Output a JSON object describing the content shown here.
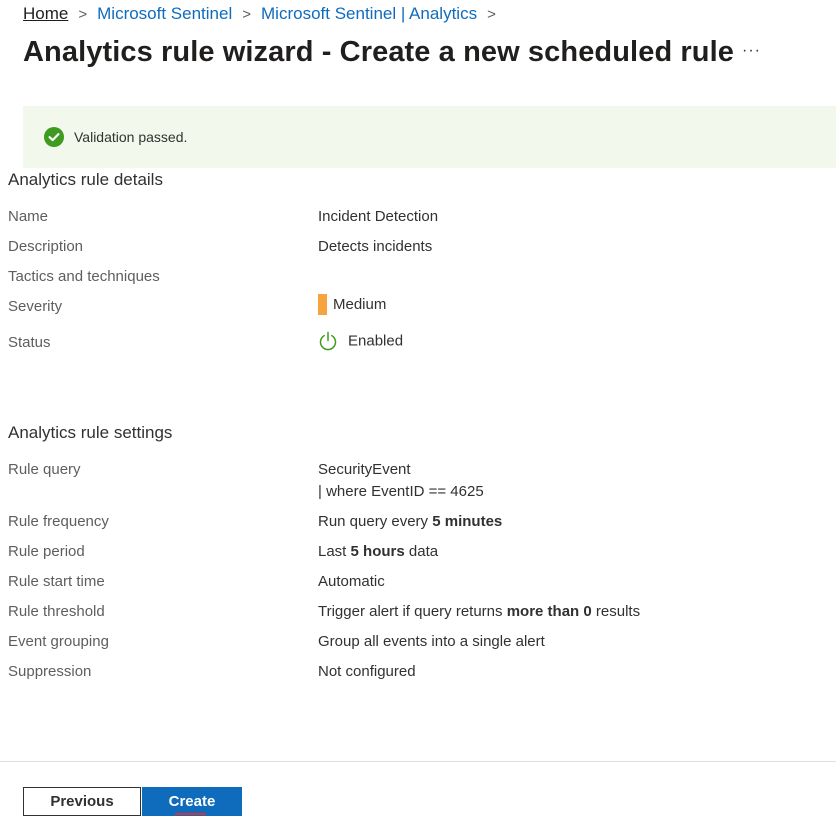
{
  "breadcrumb": {
    "items": [
      "Home",
      "Microsoft Sentinel",
      "Microsoft Sentinel | Analytics"
    ],
    "separator": ">"
  },
  "title": "Analytics rule wizard - Create a new scheduled rule",
  "more_label": "···",
  "banner": {
    "text": "Validation passed.",
    "color": "#f2f9ec",
    "icon": "check-circle-icon",
    "icon_color": "#3e9b1f"
  },
  "details": {
    "heading": "Analytics rule details",
    "name": {
      "label": "Name",
      "value": "Incident Detection"
    },
    "description": {
      "label": "Description",
      "value": "Detects incidents"
    },
    "tactics": {
      "label": "Tactics and techniques",
      "value": ""
    },
    "severity": {
      "label": "Severity",
      "value": "Medium",
      "color": "#f7a440"
    },
    "status": {
      "label": "Status",
      "value": "Enabled",
      "icon": "power-icon",
      "icon_color": "#3e9b1f"
    }
  },
  "settings": {
    "heading": "Analytics rule settings",
    "rule_query": {
      "label": "Rule query",
      "line1": "SecurityEvent",
      "line2": "| where EventID == 4625"
    },
    "rule_frequency": {
      "label": "Rule frequency",
      "prefix": "Run query every ",
      "bold": "5 minutes"
    },
    "rule_period": {
      "label": "Rule period",
      "prefix": "Last ",
      "bold": "5 hours",
      "suffix": " data"
    },
    "rule_start_time": {
      "label": "Rule start time",
      "value": "Automatic"
    },
    "rule_threshold": {
      "label": "Rule threshold",
      "prefix": "Trigger alert if query returns ",
      "bold": "more than 0",
      "suffix": " results"
    },
    "event_grouping": {
      "label": "Event grouping",
      "value": "Group all events into a single alert"
    },
    "suppression": {
      "label": "Suppression",
      "value": "Not configured"
    }
  },
  "footer": {
    "previous_label": "Previous",
    "create_label": "Create",
    "primary_color": "#0f6cbd"
  }
}
